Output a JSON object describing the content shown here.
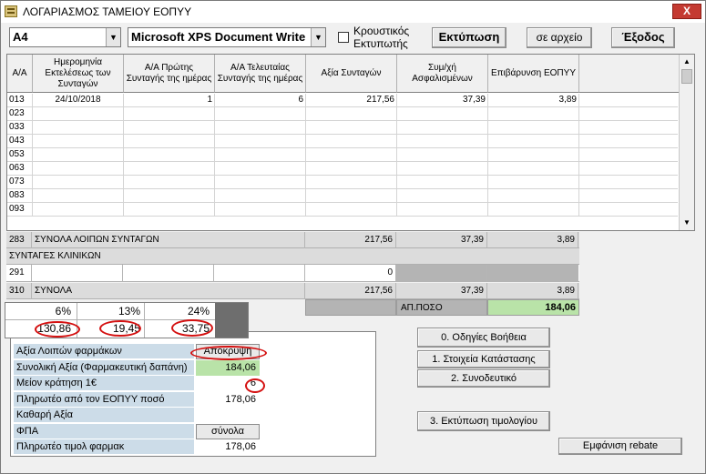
{
  "window": {
    "title": "ΛΟΓΑΡΙΑΣΜΟΣ ΤΑΜΕΙΟΥ ΕΟΠΥΥ",
    "close_label": "X"
  },
  "toolbar": {
    "paper_size": "A4",
    "printer": "Microsoft XPS Document Write",
    "impact_printer_line1": "Κρουστικός",
    "impact_printer_line2": "Εκτυπωτής",
    "print_label": "Εκτύπωση",
    "to_file_label": "σε αρχείο",
    "exit_label": "Έξοδος"
  },
  "grid": {
    "columns": [
      "Α/Α",
      "Ημερομηνία Εκτελέσεως των Συνταγών",
      "Α/Α Πρώτης Συνταγής της ημέρας",
      "Α/Α Τελευταίας Συνταγής της ημέρας",
      "Αξία Συνταγών",
      "Συμ/χή Ασφαλισμένων",
      "Επιβάρυνση ΕΟΠΥΥ"
    ],
    "rows": [
      [
        "013",
        "24/10/2018",
        "1",
        "6",
        "217,56",
        "37,39",
        "3,89"
      ],
      [
        "023",
        "",
        "",
        "",
        "",
        "",
        ""
      ],
      [
        "033",
        "",
        "",
        "",
        "",
        "",
        ""
      ],
      [
        "043",
        "",
        "",
        "",
        "",
        "",
        ""
      ],
      [
        "053",
        "",
        "",
        "",
        "",
        "",
        ""
      ],
      [
        "063",
        "",
        "",
        "",
        "",
        "",
        ""
      ],
      [
        "073",
        "",
        "",
        "",
        "",
        "",
        ""
      ],
      [
        "083",
        "",
        "",
        "",
        "",
        "",
        ""
      ],
      [
        "093",
        "",
        "",
        "",
        "",
        "",
        ""
      ]
    ]
  },
  "totals_other": {
    "code": "283",
    "label": "ΣΥΝΟΛΑ ΛΟΙΠΩΝ ΣΥΝΤΑΓΩΝ",
    "value": "217,56",
    "patient": "37,39",
    "eopyy": "3,89"
  },
  "clinics": {
    "header": "ΣΥΝΤΑΓΕΣ ΚΛΙΝΙΚΩΝ",
    "code": "291",
    "value": "0"
  },
  "totals": {
    "code": "310",
    "label": "ΣΥΝΟΛΑ",
    "value": "217,56",
    "patient": "37,39",
    "eopyy": "3,89"
  },
  "net_amount": {
    "label": "ΑΠ.ΠΟΣΟ",
    "value": "184,06"
  },
  "vat_box": {
    "headers": [
      "6%",
      "13%",
      "24%"
    ],
    "values": [
      "130,86",
      "19,45",
      "33,75"
    ]
  },
  "summary": {
    "rows": [
      {
        "label": "Αξία Λοιπών φαρμάκων",
        "value": "Απόκρυψη",
        "type": "button"
      },
      {
        "label": "Συνολική Αξία (Φαρμακευτική δαπάνη)",
        "value": "184,06",
        "type": "highlight"
      },
      {
        "label": "Μείον κράτηση 1€",
        "value": "6",
        "type": "plain"
      },
      {
        "label": "Πληρωτέο από τον ΕΟΠΥΥ ποσό",
        "value": "178,06",
        "type": "plain"
      },
      {
        "label": "Καθαρή Αξία",
        "value": "",
        "type": "plain"
      },
      {
        "label": "ΦΠΑ",
        "value": "σύνολα",
        "type": "button"
      },
      {
        "label": "Πληρωτέο τιμολ φαρμακ",
        "value": "178,06",
        "type": "plain"
      }
    ]
  },
  "actions": {
    "help": "0. Οδηγίες  Βοήθεια",
    "status": "1. Στοιχεία Κατάστασης",
    "accompanying": "2. Συνοδευτικό",
    "print_invoice": "3. Εκτύπωση τιμολογίου",
    "rebate": "Εμφάνιση rebate"
  }
}
